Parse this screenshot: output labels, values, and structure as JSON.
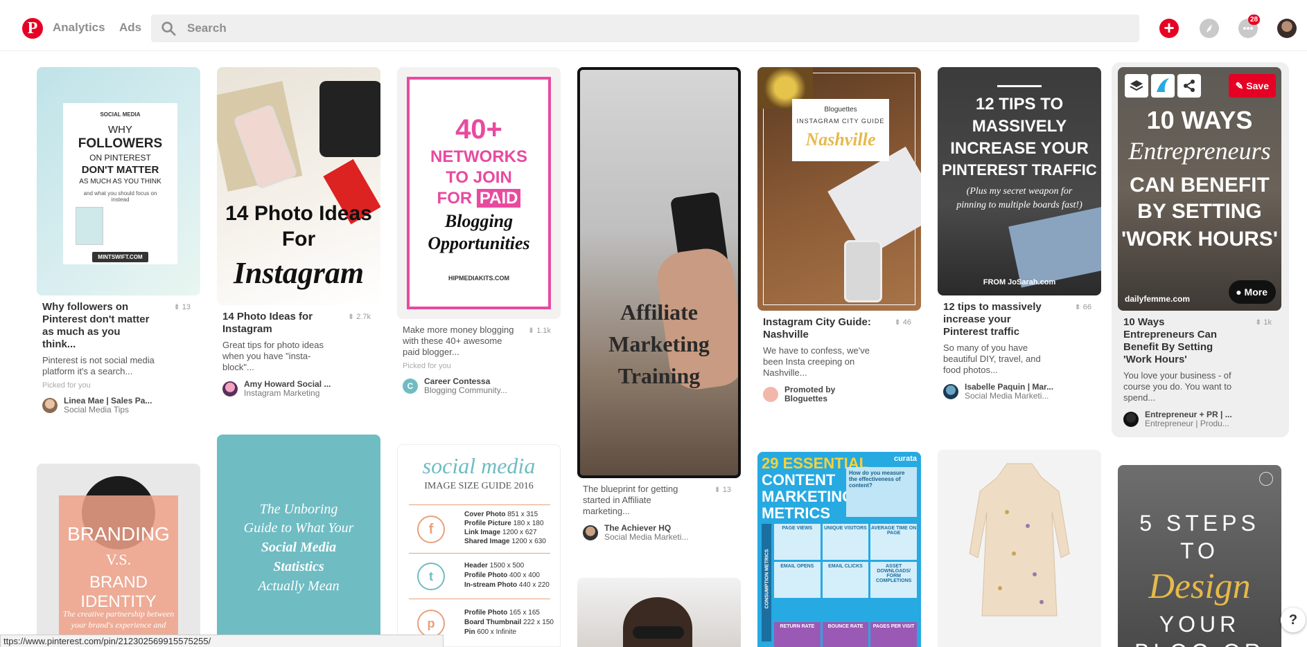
{
  "header": {
    "logo_letter": "P",
    "nav": [
      {
        "label": "Analytics"
      },
      {
        "label": "Ads"
      }
    ],
    "search_placeholder": "Search",
    "notifications_count": "28"
  },
  "pins": [
    {
      "image_text": {
        "kicker": "SOCIAL MEDIA",
        "line1": "WHY",
        "line2": "FOLLOWERS",
        "line3": "ON PINTEREST",
        "line4": "DON'T MATTER",
        "line5": "AS MUCH AS YOU THINK",
        "line6": "and what you should focus on instead",
        "site": "MINTSWIFT.COM"
      },
      "title": "Why followers on Pinterest don't matter as much as you think...",
      "saves": "13",
      "desc": "Pinterest is not social media platform it's a search...",
      "picked": "Picked for you",
      "attr_name": "Linea Mae | Sales Pa...",
      "attr_board": "Social Media Tips"
    },
    {
      "image_text": {
        "line1": "14 Photo Ideas",
        "line2": "For",
        "line3": "Instagram"
      },
      "title": "14 Photo Ideas for Instagram",
      "saves": "2.7k",
      "desc": "Great tips for photo ideas when you have \"insta-block\"...",
      "attr_name": "Amy Howard Social ...",
      "attr_board": "Instagram Marketing"
    },
    {
      "image_text": {
        "line1": "40+",
        "line2": "NETWORKS",
        "line3": "TO JOIN",
        "line4": "FOR",
        "line5": "PAID",
        "line6": "Blogging",
        "line7": "Opportunities",
        "site": "HIPMEDIAKITS.COM"
      },
      "title": "",
      "saves": "1.1k",
      "desc": "Make more money blogging with these 40+ awesome paid blogger...",
      "picked": "Picked for you",
      "attr_name": "Career Contessa",
      "attr_board": "Blogging Community..."
    },
    {
      "image_text": {
        "line1": "Affiliate",
        "line2": "Marketing",
        "line3": "Training"
      },
      "title": "",
      "saves": "13",
      "desc": "The blueprint for getting started in Affiliate marketing...",
      "attr_name": "The Achiever HQ",
      "attr_board": "Social Media Marketi..."
    },
    {
      "image_text": {
        "line1": "Bloguettes",
        "line2": "INSTAGRAM CITY GUIDE",
        "line3": "Nashville"
      },
      "title": "Instagram City Guide: Nashville",
      "saves": "46",
      "desc": "We have to confess, we've been Insta creeping on Nashville...",
      "attr_name": "Promoted by",
      "attr_board": "Bloguettes"
    },
    {
      "image_text": {
        "line1": "12 TIPS TO",
        "line2": "MASSIVELY",
        "line3": "INCREASE YOUR",
        "line4": "PINTEREST TRAFFIC",
        "line5": "(Plus my secret weapon for",
        "line6": "pinning to multiple boards fast!)",
        "site": "FROM JoSarah.com"
      },
      "title": "12 tips to massively increase your Pinterest traffic",
      "saves": "66",
      "desc": "So many of you have beautiful DIY, travel, and food photos...",
      "attr_name": "Isabelle Paquin | Mar...",
      "attr_board": "Social Media Marketi..."
    },
    {
      "image_text": {
        "line1": "10 WAYS",
        "line2": "Entrepreneurs",
        "line3": "CAN BENEFIT",
        "line4": "BY SETTING",
        "line5": "'WORK HOURS'"
      },
      "save_label": "Save",
      "more_label": "More",
      "site": "dailyfemme.com",
      "title": "10 Ways Entrepreneurs Can Benefit By Setting 'Work Hours'",
      "saves": "1k",
      "desc": "You love your business - of course you do. You want to spend...",
      "attr_name": "Entrepreneur + PR | ...",
      "attr_board": "Entrepreneur | Produ..."
    }
  ],
  "row2": {
    "branding": {
      "line1": "BRANDING",
      "line2": "V.S.",
      "line3": "BRAND IDENTITY",
      "line4": "The creative partnership between",
      "line5": "your brand's experience and"
    },
    "unboring": {
      "line1": "The Unboring",
      "line2": "Guide to What Your",
      "line3": "Social Media",
      "line4": "Statistics",
      "line5": "Actually Mean"
    },
    "sizeguide": {
      "title": "social media",
      "subtitle": "IMAGE SIZE GUIDE 2016",
      "groups": [
        {
          "rows": [
            [
              "Cover Photo",
              "851 x 315"
            ],
            [
              "Profile Picture",
              "180 x 180"
            ],
            [
              "Link Image",
              "1200 x 627"
            ],
            [
              "Shared Image",
              "1200 x 630"
            ]
          ]
        },
        {
          "rows": [
            [
              "Header",
              "1500 x 500"
            ],
            [
              "Profile Photo",
              "400 x 400"
            ],
            [
              "In-stream Photo",
              "440 x 220"
            ]
          ]
        },
        {
          "rows": [
            [
              "Profile Photo",
              "165 x 165"
            ],
            [
              "Board Thumbnail",
              "222 x 150"
            ],
            [
              "Pin",
              "600 x Infinite"
            ]
          ]
        }
      ]
    },
    "metrics": {
      "line1": "29 ESSENTIAL",
      "line2": "CONTENT",
      "line3": "MARKETING",
      "line4": "METRICS",
      "brand": "curata",
      "q": "How do you measure the effectiveness of content?",
      "cells": [
        "PAGE VIEWS",
        "UNIQUE VISITORS",
        "AVERAGE TIME ON PAGE",
        "EMAIL OPENS",
        "EMAIL CLICKS",
        "ASSET DOWNLOADS/ FORM COMPLETIONS",
        "RETURN RATE",
        "BOUNCE RATE",
        "PAGES PER VISIT"
      ],
      "side": "CONSUMPTION METRICS"
    },
    "steps": {
      "line1": "5 STEPS",
      "line2": "TO",
      "line3": "Design",
      "line4": "YOUR",
      "line5": "BLOG OR"
    }
  },
  "status_url": "ttps://www.pinterest.com/pin/212302569915575255/",
  "help_label": "?",
  "colors": {
    "brand": "#e60023",
    "pink": "#e84a9f",
    "teal": "#6fbcc3",
    "metrics_blue": "#27a9e1"
  }
}
